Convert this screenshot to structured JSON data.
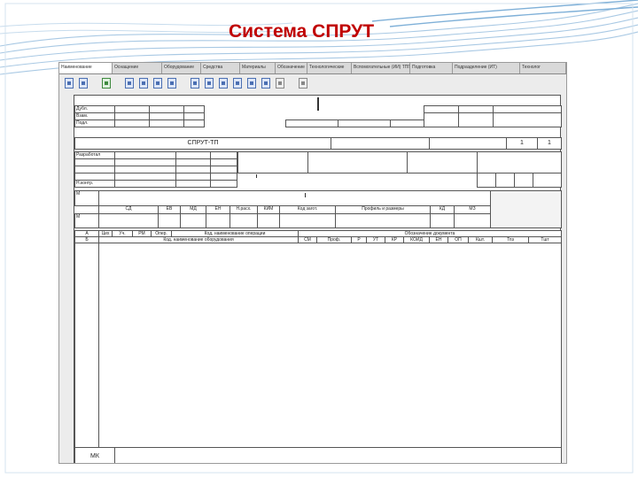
{
  "slide": {
    "title": "Система СПРУТ"
  },
  "app": {
    "tabs": [
      {
        "label": "Наименование"
      },
      {
        "label": "Оснащение"
      },
      {
        "label": "Оборудование"
      },
      {
        "label": "Средства"
      },
      {
        "label": "Материалы"
      },
      {
        "label": "Обозначение"
      },
      {
        "label": "Технологические"
      },
      {
        "label": "Вспомогательные (ИИ) ТПП"
      },
      {
        "label": "Подготовка"
      },
      {
        "label": "Подразделение (ИТ)"
      },
      {
        "label": "Технолог"
      }
    ]
  },
  "form": {
    "doc_code": "СПРУТ-ТП",
    "sheet_num": "1",
    "sheet_total": "1",
    "hdr_dubl": "Дубл.",
    "hdr_vzam": "Взам.",
    "hdr_podl": "Подл.",
    "razrab": "Разработал",
    "n_kontr": "Н.контр.",
    "m_label": "М",
    "m2_label": "М",
    "col_sd": "СД",
    "col_ev": "ЕВ",
    "col_md": "МД",
    "col_en": "ЕН",
    "col_nrash": "Н.расх.",
    "col_kim": "КИМ",
    "col_kodzag": "Код загот.",
    "col_profil": "Профиль и размеры",
    "col_kd": "КД",
    "col_mz": "МЗ",
    "row_a": "А",
    "row_b": "Б",
    "col_tseh": "Цех",
    "col_uch": "Уч.",
    "col_rm": "РМ",
    "col_oper": "Опер.",
    "col_kod_oper": "Код, наименование операции",
    "col_oboz_doc": "Обозначение документа",
    "col_kod_obor": "Код, наименование оборудования",
    "col_sm": "СМ",
    "col_prof": "Проф.",
    "col_r": "Р",
    "col_ut": "УТ",
    "col_kr": "КР",
    "col_koid": "КОИД",
    "col_en2": "ЕН",
    "col_op": "ОП",
    "col_kpit": "Кшт.",
    "col_tpz": "Тпз",
    "col_tsht": "Тшт",
    "footer_mk": "МК"
  }
}
